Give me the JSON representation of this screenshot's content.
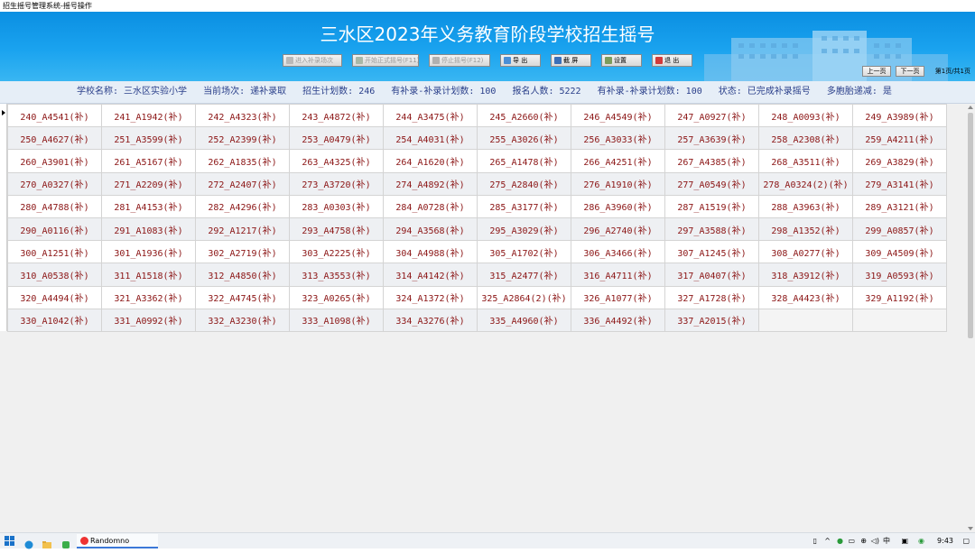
{
  "window": {
    "title": "招生摇号管理系统-摇号操作"
  },
  "banner": {
    "title": "三水区2023年义务教育阶段学校招生摇号"
  },
  "toolbar": {
    "buttons": [
      {
        "label": "进入补录场次",
        "enabled": false,
        "icon": "enter-icon"
      },
      {
        "label": "开始正式摇号(F11)",
        "enabled": false,
        "icon": "start-icon"
      },
      {
        "label": "停止摇号(F12)",
        "enabled": false,
        "icon": "stop-icon"
      },
      {
        "label": "导 出",
        "enabled": true,
        "icon": "export-icon"
      },
      {
        "label": "截 屏",
        "enabled": true,
        "icon": "screenshot-icon"
      },
      {
        "label": "设置",
        "enabled": true,
        "icon": "settings-icon"
      },
      {
        "label": "退 出",
        "enabled": true,
        "icon": "exit-icon"
      }
    ]
  },
  "pager": {
    "prev": "上一页",
    "next": "下一页",
    "info": "第1页/共1页"
  },
  "info": {
    "school": "学校名称: 三水区实验小学",
    "session": "当前场次: 递补录取",
    "plan": "招生计划数: 246",
    "supplement_plan_1": "有补录-补录计划数: 100",
    "applicants": "报名人数: 5222",
    "supplement_plan_2": "有补录-补录计划数: 100",
    "status": "状态: 已完成补录摇号",
    "twins": "多胞胎递减: 是"
  },
  "results": [
    [
      "240_A4541(补)",
      "241_A1942(补)",
      "242_A4323(补)",
      "243_A4872(补)",
      "244_A3475(补)",
      "245_A2660(补)",
      "246_A4549(补)",
      "247_A0927(补)",
      "248_A0093(补)",
      "249_A3989(补)"
    ],
    [
      "250_A4627(补)",
      "251_A3599(补)",
      "252_A2399(补)",
      "253_A0479(补)",
      "254_A4031(补)",
      "255_A3026(补)",
      "256_A3033(补)",
      "257_A3639(补)",
      "258_A2308(补)",
      "259_A4211(补)"
    ],
    [
      "260_A3901(补)",
      "261_A5167(补)",
      "262_A1835(补)",
      "263_A4325(补)",
      "264_A1620(补)",
      "265_A1478(补)",
      "266_A4251(补)",
      "267_A4385(补)",
      "268_A3511(补)",
      "269_A3829(补)"
    ],
    [
      "270_A0327(补)",
      "271_A2209(补)",
      "272_A2407(补)",
      "273_A3720(补)",
      "274_A4892(补)",
      "275_A2840(补)",
      "276_A1910(补)",
      "277_A0549(补)",
      "278_A0324(2)(补)",
      "279_A3141(补)"
    ],
    [
      "280_A4788(补)",
      "281_A4153(补)",
      "282_A4296(补)",
      "283_A0303(补)",
      "284_A0728(补)",
      "285_A3177(补)",
      "286_A3960(补)",
      "287_A1519(补)",
      "288_A3963(补)",
      "289_A3121(补)"
    ],
    [
      "290_A0116(补)",
      "291_A1083(补)",
      "292_A1217(补)",
      "293_A4758(补)",
      "294_A3568(补)",
      "295_A3029(补)",
      "296_A2740(补)",
      "297_A3588(补)",
      "298_A1352(补)",
      "299_A0857(补)"
    ],
    [
      "300_A1251(补)",
      "301_A1936(补)",
      "302_A2719(补)",
      "303_A2225(补)",
      "304_A4988(补)",
      "305_A1702(补)",
      "306_A3466(补)",
      "307_A1245(补)",
      "308_A0277(补)",
      "309_A4509(补)"
    ],
    [
      "310_A0538(补)",
      "311_A1518(补)",
      "312_A4850(补)",
      "313_A3553(补)",
      "314_A4142(补)",
      "315_A2477(补)",
      "316_A4711(补)",
      "317_A0407(补)",
      "318_A3912(补)",
      "319_A0593(补)"
    ],
    [
      "320_A4494(补)",
      "321_A3362(补)",
      "322_A4745(补)",
      "323_A0265(补)",
      "324_A1372(补)",
      "325_A2864(2)(补)",
      "326_A1077(补)",
      "327_A1728(补)",
      "328_A4423(补)",
      "329_A1192(补)"
    ],
    [
      "330_A1042(补)",
      "331_A0992(补)",
      "332_A3230(补)",
      "333_A1098(补)",
      "334_A3276(补)",
      "335_A4960(补)",
      "336_A4492(补)",
      "337_A2015(补)",
      "",
      ""
    ]
  ],
  "taskbar": {
    "app_label": "Randomno",
    "ime": "中",
    "time": "9:43"
  }
}
